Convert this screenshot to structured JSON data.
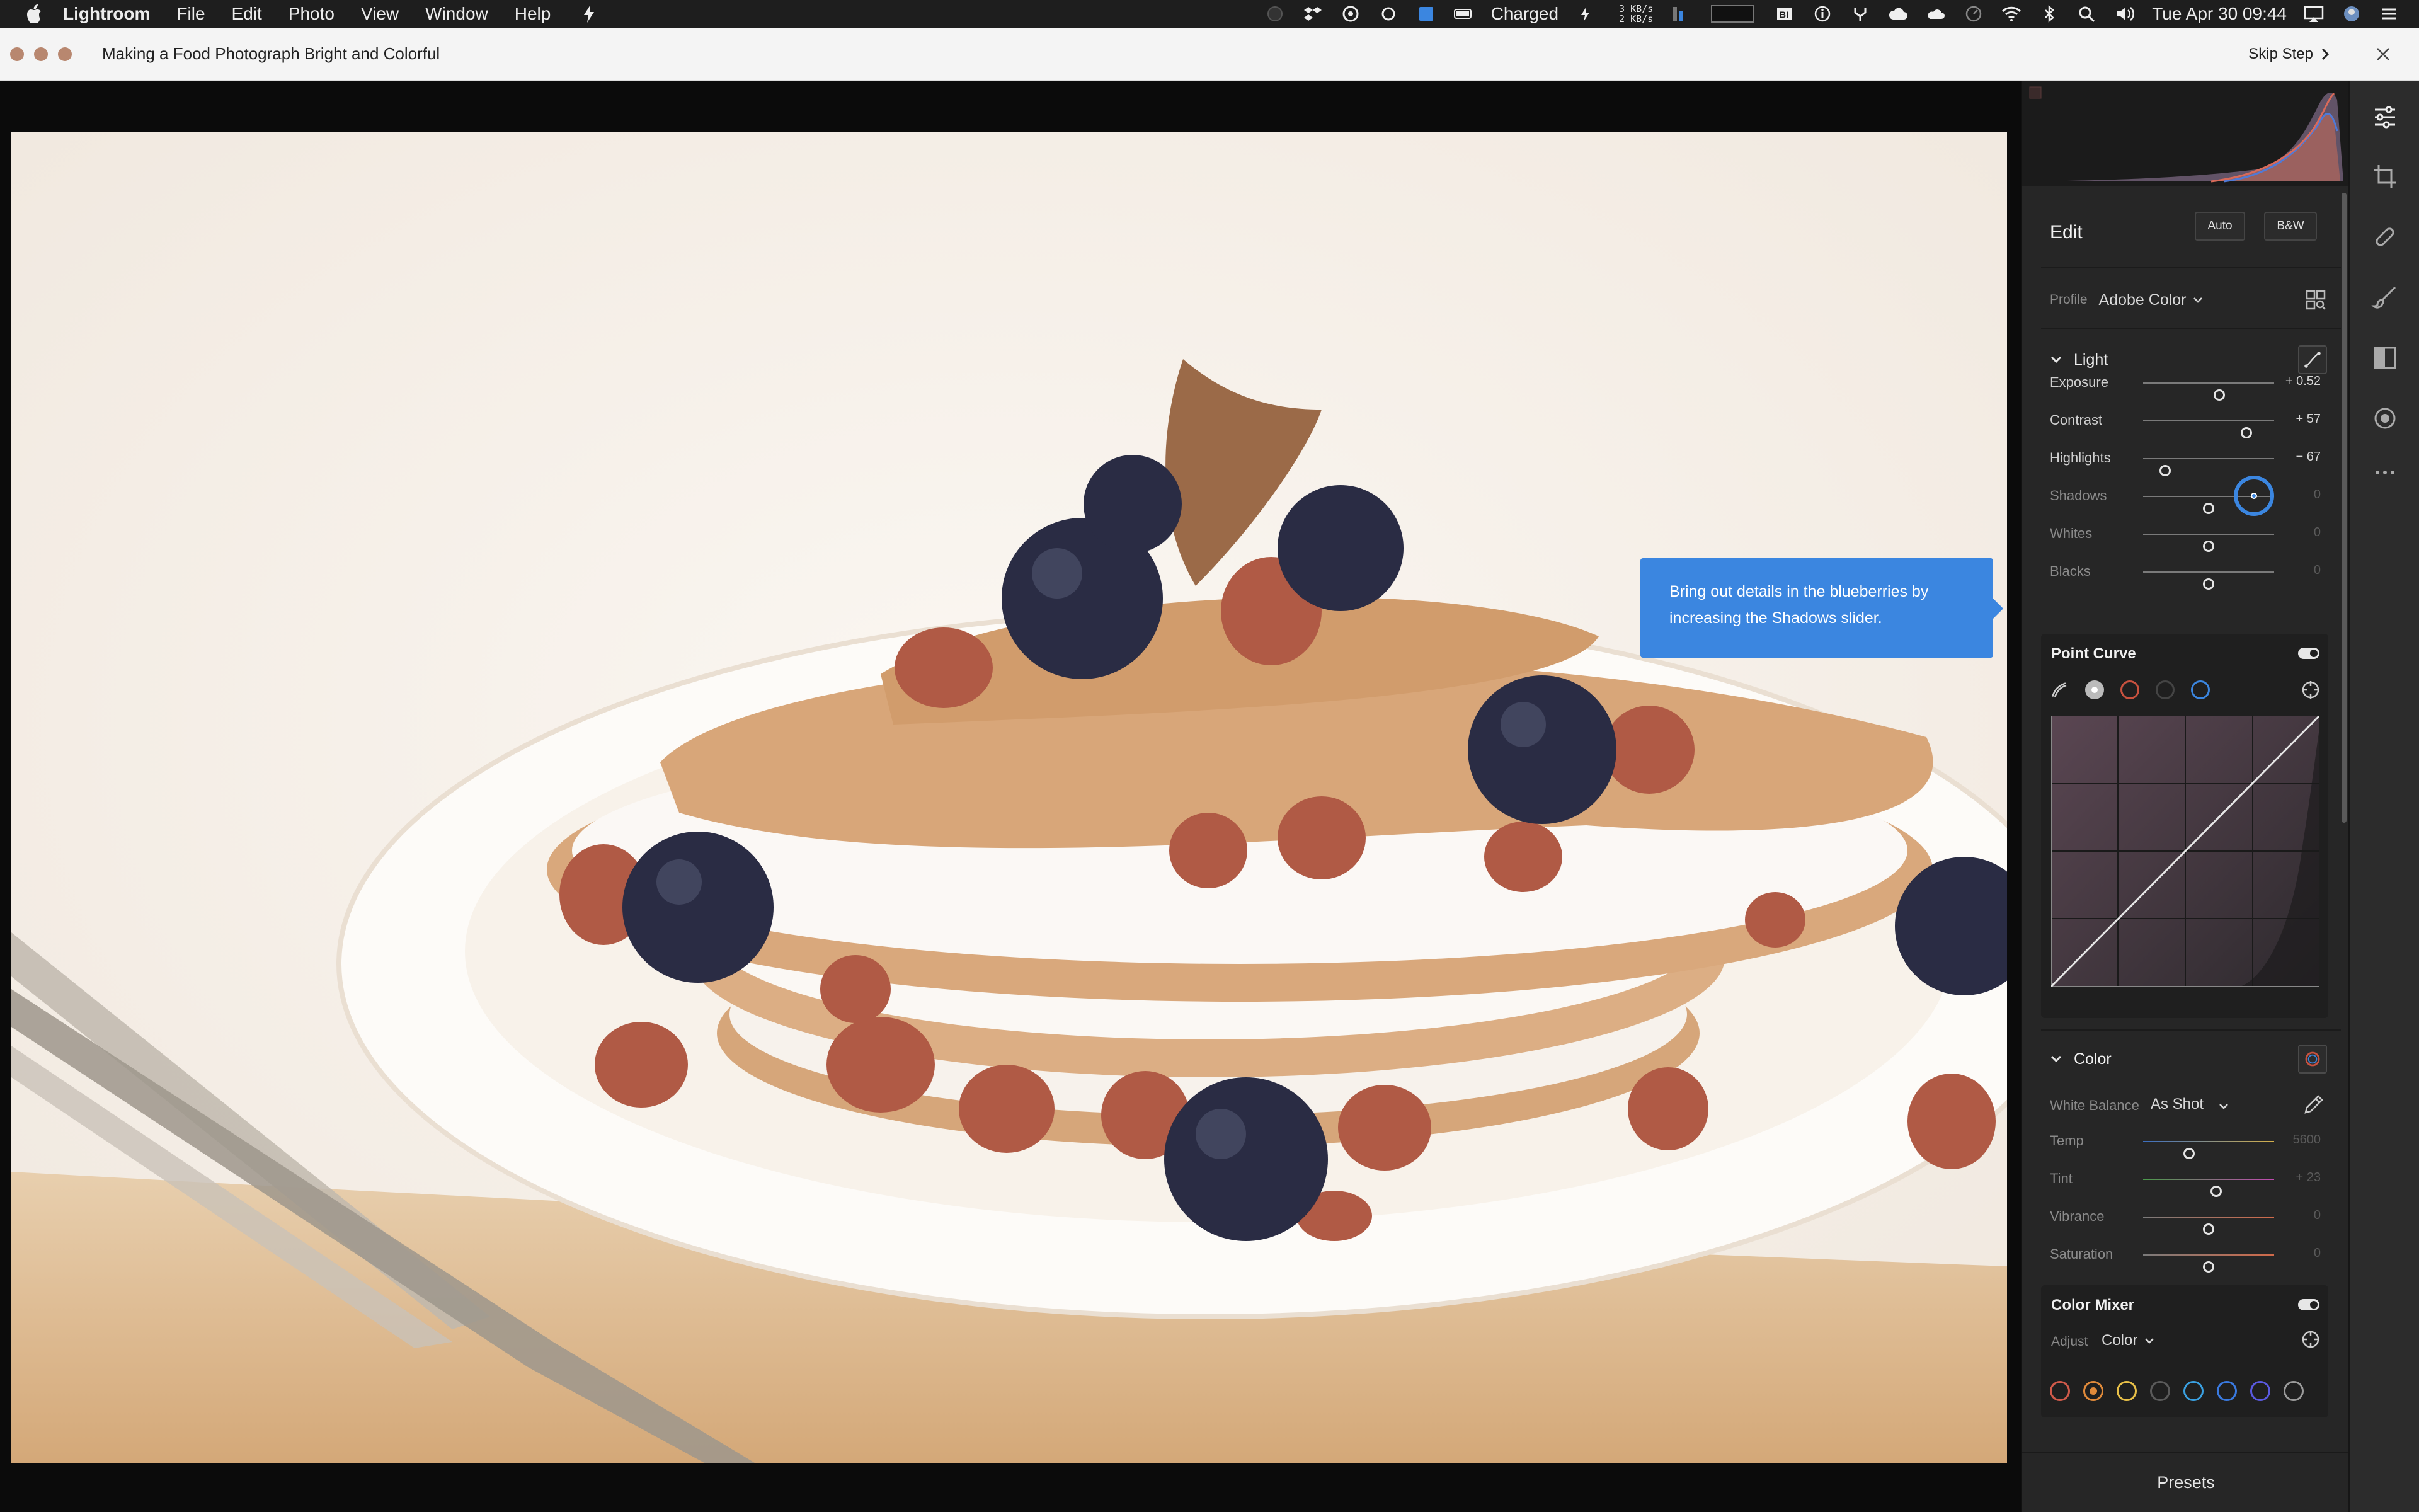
{
  "menubar": {
    "app_name": "Lightroom",
    "menus": [
      "File",
      "Edit",
      "Photo",
      "View",
      "Window",
      "Help"
    ],
    "battery_label": "Charged",
    "network_up": "3 KB/s",
    "network_down": "2 KB/s",
    "datetime": "Tue Apr 30  09:44"
  },
  "tutorial": {
    "title": "Making a Food Photograph Bright and Colorful",
    "skip_label": "Skip Step",
    "tip_text": "Bring out details in the blueberries by increasing the Shadows slider."
  },
  "edit": {
    "title": "Edit",
    "auto_label": "Auto",
    "bw_label": "B&W",
    "profile_label": "Profile",
    "profile_value": "Adobe Color"
  },
  "light": {
    "title": "Light",
    "sliders": [
      {
        "label": "Exposure",
        "value": "+ 0.52",
        "position": 0.58
      },
      {
        "label": "Contrast",
        "value": "+ 57",
        "position": 0.79
      },
      {
        "label": "Highlights",
        "value": "− 67",
        "position": 0.17
      },
      {
        "label": "Shadows",
        "value": "0",
        "position": 0.5
      },
      {
        "label": "Whites",
        "value": "0",
        "position": 0.5
      },
      {
        "label": "Blacks",
        "value": "0",
        "position": 0.5
      }
    ]
  },
  "point_curve": {
    "title": "Point Curve",
    "enabled": true,
    "channels": [
      "parametric",
      "rgb",
      "red",
      "green",
      "blue"
    ]
  },
  "color": {
    "title": "Color",
    "wb_label": "White Balance",
    "wb_value": "As Shot",
    "sliders": [
      {
        "label": "Temp",
        "value": "5600",
        "position": 0.35
      },
      {
        "label": "Tint",
        "value": "+ 23",
        "position": 0.56
      },
      {
        "label": "Vibrance",
        "value": "0",
        "position": 0.5
      },
      {
        "label": "Saturation",
        "value": "0",
        "position": 0.5
      }
    ]
  },
  "color_mixer": {
    "title": "Color Mixer",
    "enabled": true,
    "adjust_label": "Adjust",
    "adjust_value": "Color",
    "swatches": [
      "#d05a4a",
      "#e08a3a",
      "#e8c048",
      "#5a5a5a",
      "#3aa0e0",
      "#3a7ae0",
      "#5a5ae0",
      "#9a9a9a"
    ]
  },
  "presets_label": "Presets",
  "colors": {
    "accent": "#3b86e0",
    "panel_bg": "#262626",
    "tutorial_bar": "#f4f4f4"
  }
}
